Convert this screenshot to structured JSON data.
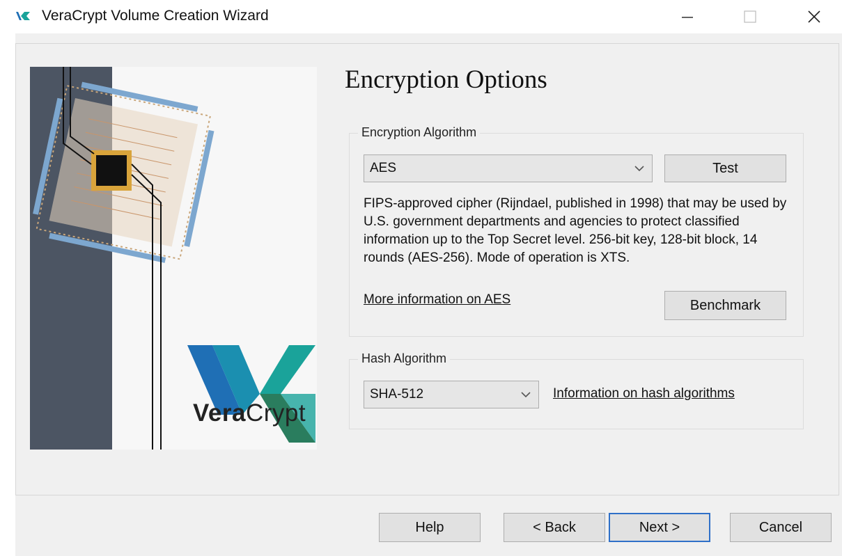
{
  "window": {
    "title": "VeraCrypt Volume Creation Wizard"
  },
  "side_image": {
    "brand_bold": "Vera",
    "brand_regular": "Crypt"
  },
  "page": {
    "title": "Encryption Options"
  },
  "encryption": {
    "group_label": "Encryption Algorithm",
    "selected_algorithm": "AES",
    "test_button": "Test",
    "description": "FIPS-approved cipher (Rijndael, published in 1998) that may be used by U.S. government departments and agencies to protect classified information up to the Top Secret level. 256-bit key, 128-bit block, 14 rounds (AES-256). Mode of operation is XTS.",
    "more_info_link": "More information on AES",
    "benchmark_button": "Benchmark"
  },
  "hash": {
    "group_label": "Hash Algorithm",
    "selected_algorithm": "SHA-512",
    "info_link": "Information on hash algorithms"
  },
  "footer": {
    "help": "Help",
    "back": "< Back",
    "next": "Next >",
    "cancel": "Cancel"
  },
  "colors": {
    "accent": "#2f70c8",
    "panel_bg": "#f0f0f0",
    "logo_teal": "#1aa39a",
    "logo_blue": "#1f6fb5"
  }
}
